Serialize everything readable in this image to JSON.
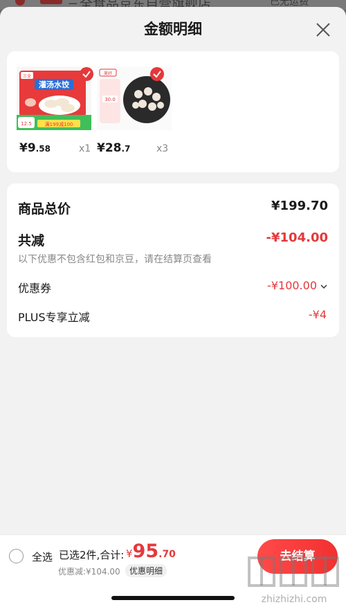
{
  "background": {
    "store_name": "三全食品京东自营旗舰店",
    "right_text": "已无运费"
  },
  "sheet": {
    "title": "金额明细"
  },
  "products": [
    {
      "price_int": "¥9",
      "price_dec": ".58",
      "qty": "x1",
      "brand": "三全",
      "title": "灌汤水饺",
      "tag1": "12.5",
      "tag2": "满199减100"
    },
    {
      "price_int": "¥28",
      "price_dec": ".7",
      "qty": "x3",
      "brand": "美好",
      "tag1": "30.0"
    }
  ],
  "prices": {
    "total_label": "商品总价",
    "total_value": "¥199.70",
    "reduce_label": "共减",
    "reduce_value": "-¥104.00",
    "note": "以下优惠不包含红包和京豆，请在结算页查看",
    "coupon_label": "优惠券",
    "coupon_value": "-¥100.00",
    "plus_label": "PLUS专享立减",
    "plus_value": "-¥4"
  },
  "bottom": {
    "select_all": "全选",
    "summary": "已选2件,合计:",
    "currency": "¥",
    "total_int": "95",
    "total_dec": ".70",
    "discount_line": "优惠减:¥104.00",
    "detail_tag": "优惠明细",
    "checkout": "去结算"
  },
  "watermark": "zhizhizhi.com",
  "colors": {
    "accent": "#e4393c",
    "checkout": "#f23030"
  }
}
